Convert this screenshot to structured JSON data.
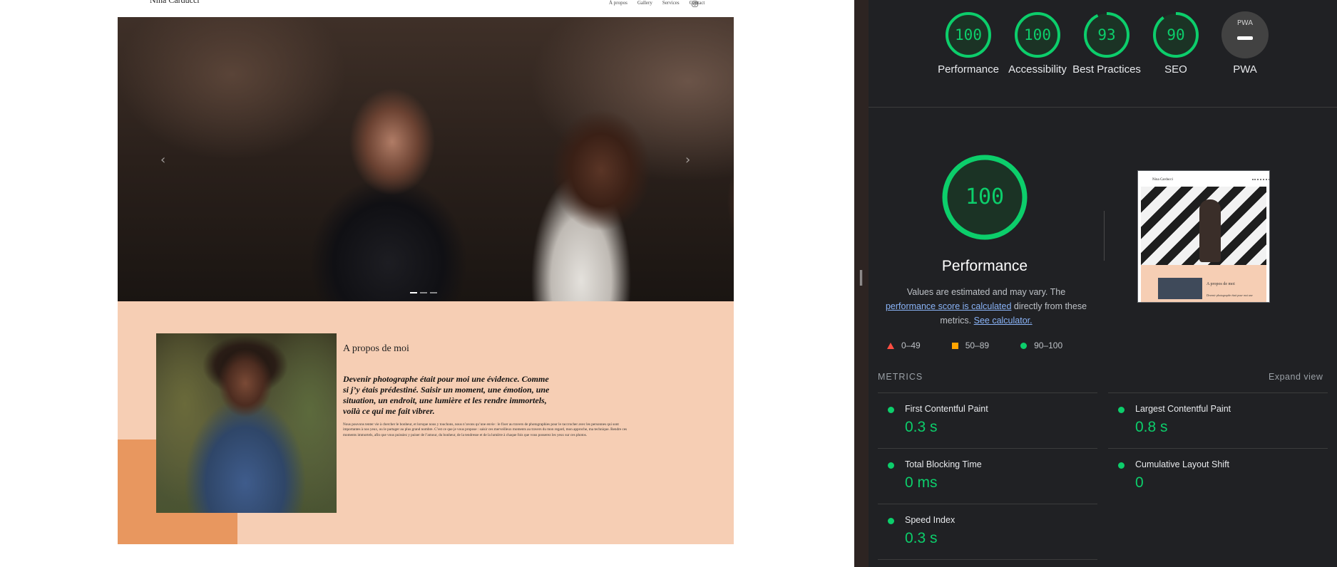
{
  "site": {
    "name": "Nina Carducci",
    "nav": [
      "À propos",
      "Gallery",
      "Services",
      "Contact"
    ],
    "about": {
      "title": "A propos de moi",
      "lead": "Devenir photographe était pour moi une évidence. Comme si j’y étais prédestiné. Saisir un moment, une émotion, une situation, un endroit, une lumière et les rendre immortels, voilà ce qui me fait vibrer.",
      "body": "Nous pouvons tenter vie à chercher le bonheur, et lorsque nous y touchons, nous n’avons qu’une envie : le fixer au travers de photographies pour le raccrocher avec les personnes qui sont importantes à nos yeux, ou le partager au plus grand nombre. C’est ce que je vous propose : saisir ces merveilleux moments au travers du mon regard, mon approche, ma technique. Rendre ces moments immortels, afin que vous puissiez y puiser de l’amour, du bonheur, de la tendresse et de la lumière à chaque fois que vous posserez les yeux sur ces photos."
    }
  },
  "lighthouse": {
    "scores": [
      {
        "label": "Performance",
        "value": 100
      },
      {
        "label": "Accessibility",
        "value": 100
      },
      {
        "label": "Best Practices",
        "value": 93
      },
      {
        "label": "SEO",
        "value": 90
      }
    ],
    "pwa": {
      "label": "PWA",
      "badge": "PWA"
    },
    "focus": {
      "score": 100,
      "title": "Performance",
      "desc_pre": "Values are estimated and may vary. The ",
      "link1": "performance score is calculated",
      "desc_mid": " directly from these metrics. ",
      "link2": "See calculator."
    },
    "screenshot": {
      "site_name": "Nina Carducci",
      "title": "A propos de moi",
      "lead": "Devenir photographe était pour moi une"
    },
    "legend": [
      "0–49",
      "50–89",
      "90–100"
    ],
    "metrics_label": "METRICS",
    "expand_label": "Expand view",
    "metrics": [
      {
        "name": "First Contentful Paint",
        "value": "0.3 s"
      },
      {
        "name": "Largest Contentful Paint",
        "value": "0.8 s"
      },
      {
        "name": "Total Blocking Time",
        "value": "0 ms"
      },
      {
        "name": "Cumulative Layout Shift",
        "value": "0"
      },
      {
        "name": "Speed Index",
        "value": "0.3 s"
      }
    ],
    "colors": {
      "pass": "#0cce6b",
      "average": "#ffa400",
      "fail": "#ff4e42",
      "link": "#8ab4f8"
    }
  }
}
